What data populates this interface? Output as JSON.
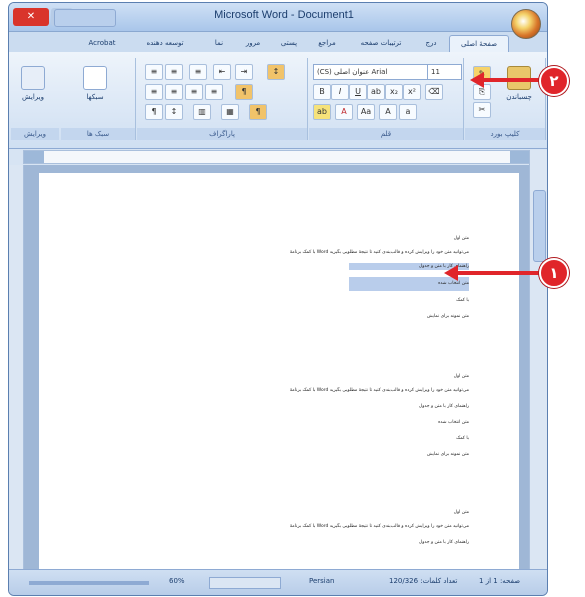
{
  "window": {
    "title": "Microsoft Word - Document1",
    "qat_label": ""
  },
  "tabs": [
    {
      "label": "صفحهٔ اصلی"
    },
    {
      "label": "درج"
    },
    {
      "label": "ترتیبات صفحه"
    },
    {
      "label": "مراجع"
    },
    {
      "label": "پستی"
    },
    {
      "label": "مرور"
    },
    {
      "label": "نما"
    },
    {
      "label": "توسعه دهنده"
    },
    {
      "label": "Acrobat"
    }
  ],
  "ribbon": {
    "font_name": "(CS) عنوان اصلی Arial",
    "font_size": "11",
    "group_font": "قلم",
    "group_paragraph": "پاراگراف",
    "group_clipboard": "کلیپ بورد",
    "group_styles": "سبک ها",
    "group_editing": "ویرایش",
    "paste_label": "چسباندن",
    "styles_label": "سبکها",
    "editing_label": "ویرایش"
  },
  "document": {
    "lines": [
      {
        "text": "متن اول",
        "sel": false
      },
      {
        "text": "با کمک برنامهٔ Word می‌توانید متن خود را ویرایش کرده و قالب‌بندی کنید تا نتیجهٔ مطلوبی بگیرید",
        "sel": false
      },
      {
        "text": "راهنمای کار با متن و جدول",
        "sel": true
      },
      {
        "text": "متن انتخاب شده",
        "sel": true
      },
      {
        "text": "با کمک",
        "sel": false
      },
      {
        "text": "متن نمونه برای نمایش",
        "sel": false
      },
      {
        "text": "متن اول",
        "sel": false
      },
      {
        "text": "با کمک برنامهٔ Word می‌توانید متن خود را ویرایش کرده و قالب‌بندی کنید تا نتیجهٔ مطلوبی بگیرید",
        "sel": false
      },
      {
        "text": "راهنمای کار با متن و جدول",
        "sel": false
      },
      {
        "text": "متن انتخاب شده",
        "sel": false
      },
      {
        "text": "با کمک",
        "sel": false
      },
      {
        "text": "متن نمونه برای نمایش",
        "sel": false
      },
      {
        "text": "متن اول",
        "sel": false
      },
      {
        "text": "با کمک برنامهٔ Word می‌توانید متن خود را ویرایش کرده و قالب‌بندی کنید تا نتیجهٔ مطلوبی بگیرید",
        "sel": false
      },
      {
        "text": "راهنمای کار با متن و جدول",
        "sel": false
      }
    ]
  },
  "status": {
    "page": "صفحه: 1 از 1",
    "words": "تعداد کلمات: 120/326",
    "language": "Persian",
    "zoom": "60%"
  },
  "callouts": {
    "one": "۱",
    "two": "۲"
  },
  "colors": {
    "accent": "#e0252a",
    "ribbon": "#cfdff2",
    "selection": "#b9cdeb"
  }
}
